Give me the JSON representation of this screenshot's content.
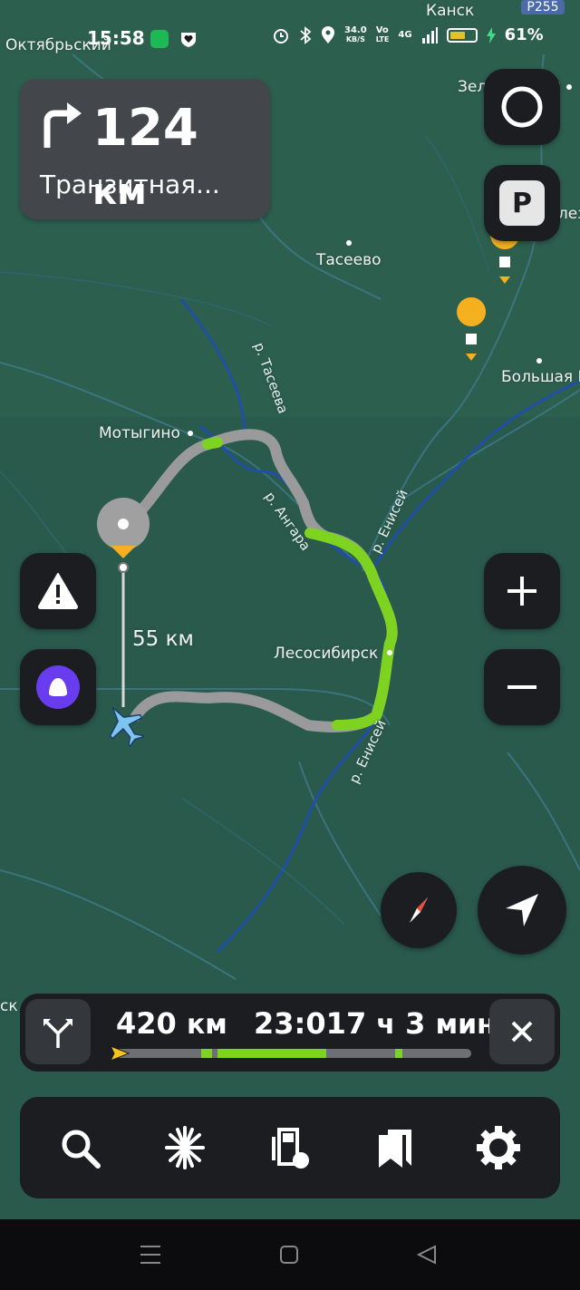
{
  "status_bar": {
    "time": "15:58",
    "net_speed": "34.0",
    "net_unit": "KB/S",
    "volte_top": "Vo",
    "volte_bottom": "LTE",
    "network": "4G",
    "battery_percent": 61,
    "battery_text": "61%"
  },
  "maneuver": {
    "distance_value": "124",
    "distance_unit": "км",
    "street": "Транзитная..."
  },
  "map": {
    "places": [
      "Октябрьский",
      "Канск",
      "Зеленогорск",
      "Тасеево",
      "Большая М",
      "Мотыгино",
      "Лесосибирск",
      "Элезн",
      "ск"
    ],
    "rivers": [
      "р. Тасеева",
      "р. Ангара",
      "р. Енисей",
      "р. Енисей"
    ],
    "road_sign": "Р255",
    "segment_distance": "55 км"
  },
  "route_bar": {
    "distance_value": "420",
    "distance_unit": "км",
    "arrival_time": "23:01",
    "duration_h": "7",
    "duration_h_unit": "ч",
    "duration_m": "3",
    "duration_m_unit": "мин",
    "progress_fraction": 0.01
  },
  "toolbar": {
    "items": [
      "search-icon",
      "gas-flash-icon",
      "fuel-icon",
      "bookmarks-icon",
      "settings-icon"
    ]
  },
  "colors": {
    "map_bg": "#2a5a4c",
    "route_gray": "#9a9a9a",
    "route_green": "#7ed321",
    "panel": "#1b1d21",
    "accent_alice": "#6a3cf0",
    "compass_red": "#e84c3d"
  }
}
